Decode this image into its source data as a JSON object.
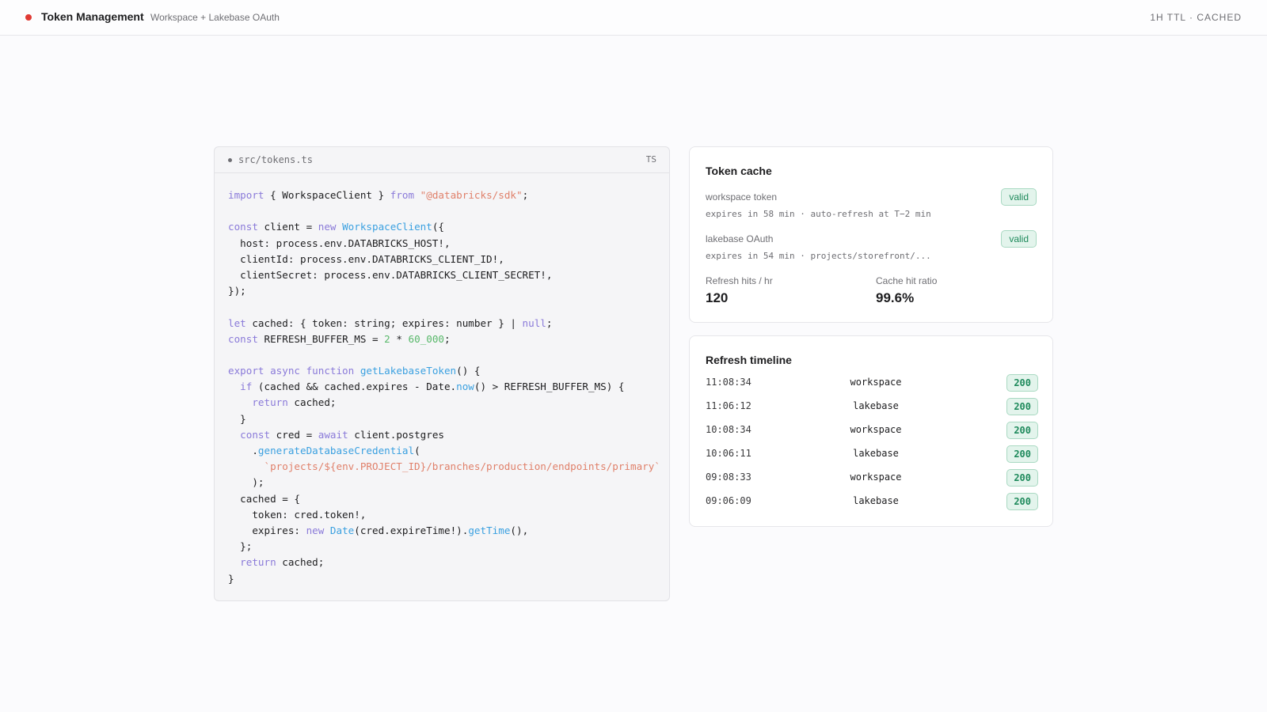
{
  "header": {
    "title": "Token Management",
    "subtitle": "Workspace + Lakebase OAuth",
    "status": "1H TTL · CACHED",
    "dot_color": "#e03a34"
  },
  "code": {
    "filename": "src/tokens.ts",
    "language": "TS",
    "lines": [
      [
        [
          "kw",
          "import"
        ],
        [
          "p",
          " { WorkspaceClient } "
        ],
        [
          "kw",
          "from"
        ],
        [
          "p",
          " "
        ],
        [
          "str",
          "\"@databricks/sdk\""
        ],
        [
          "p",
          ";"
        ]
      ],
      [],
      [
        [
          "kw",
          "const"
        ],
        [
          "p",
          " client = "
        ],
        [
          "kw",
          "new"
        ],
        [
          "p",
          " "
        ],
        [
          "fn",
          "WorkspaceClient"
        ],
        [
          "p",
          "({"
        ]
      ],
      [
        [
          "p",
          "  host: process.env.DATABRICKS_HOST!,"
        ]
      ],
      [
        [
          "p",
          "  clientId: process.env.DATABRICKS_CLIENT_ID!,"
        ]
      ],
      [
        [
          "p",
          "  clientSecret: process.env.DATABRICKS_CLIENT_SECRET!,"
        ]
      ],
      [
        [
          "p",
          "});"
        ]
      ],
      [],
      [
        [
          "kw",
          "let"
        ],
        [
          "p",
          " cached: { token: string; expires: number } | "
        ],
        [
          "kw",
          "null"
        ],
        [
          "p",
          ";"
        ]
      ],
      [
        [
          "kw",
          "const"
        ],
        [
          "p",
          " REFRESH_BUFFER_MS = "
        ],
        [
          "num",
          "2"
        ],
        [
          "p",
          " * "
        ],
        [
          "num",
          "60_000"
        ],
        [
          "p",
          ";"
        ]
      ],
      [],
      [
        [
          "kw",
          "export async function"
        ],
        [
          "p",
          " "
        ],
        [
          "fn",
          "getLakebaseToken"
        ],
        [
          "p",
          "() {"
        ]
      ],
      [
        [
          "p",
          "  "
        ],
        [
          "kw",
          "if"
        ],
        [
          "p",
          " (cached && cached.expires - Date."
        ],
        [
          "fn",
          "now"
        ],
        [
          "p",
          "() > REFRESH_BUFFER_MS) {"
        ]
      ],
      [
        [
          "p",
          "    "
        ],
        [
          "kw",
          "return"
        ],
        [
          "p",
          " cached;"
        ]
      ],
      [
        [
          "p",
          "  }"
        ]
      ],
      [
        [
          "p",
          "  "
        ],
        [
          "kw",
          "const"
        ],
        [
          "p",
          " cred = "
        ],
        [
          "kw",
          "await"
        ],
        [
          "p",
          " client.postgres"
        ]
      ],
      [
        [
          "p",
          "    ."
        ],
        [
          "fn",
          "generateDatabaseCredential"
        ],
        [
          "p",
          "("
        ]
      ],
      [
        [
          "p",
          "      "
        ],
        [
          "str",
          "`projects/${env.PROJECT_ID}/branches/production/endpoints/primary`"
        ]
      ],
      [
        [
          "p",
          "    );"
        ]
      ],
      [
        [
          "p",
          "  cached = {"
        ]
      ],
      [
        [
          "p",
          "    token: cred.token!,"
        ]
      ],
      [
        [
          "p",
          "    expires: "
        ],
        [
          "kw",
          "new"
        ],
        [
          "p",
          " "
        ],
        [
          "fn",
          "Date"
        ],
        [
          "p",
          "(cred.expireTime!)."
        ],
        [
          "fn",
          "getTime"
        ],
        [
          "p",
          "(),"
        ]
      ],
      [
        [
          "p",
          "  };"
        ]
      ],
      [
        [
          "p",
          "  "
        ],
        [
          "kw",
          "return"
        ],
        [
          "p",
          " cached;"
        ]
      ],
      [
        [
          "p",
          "}"
        ]
      ]
    ]
  },
  "cache": {
    "title": "Token cache",
    "tokens": [
      {
        "label": "workspace token",
        "status": "valid",
        "meta": "expires in 58 min · auto-refresh at T−2 min"
      },
      {
        "label": "lakebase OAuth",
        "status": "valid",
        "meta": "expires in 54 min · projects/storefront/..."
      }
    ],
    "stats": [
      {
        "label": "Refresh hits / hr",
        "value": "120"
      },
      {
        "label": "Cache hit ratio",
        "value": "99.6%"
      }
    ]
  },
  "timeline": {
    "title": "Refresh timeline",
    "rows": [
      {
        "time": "11:08:34",
        "source": "workspace",
        "code": "200"
      },
      {
        "time": "11:06:12",
        "source": "lakebase",
        "code": "200"
      },
      {
        "time": "10:08:34",
        "source": "workspace",
        "code": "200"
      },
      {
        "time": "10:06:11",
        "source": "lakebase",
        "code": "200"
      },
      {
        "time": "09:08:33",
        "source": "workspace",
        "code": "200"
      },
      {
        "time": "09:06:09",
        "source": "lakebase",
        "code": "200"
      }
    ]
  }
}
